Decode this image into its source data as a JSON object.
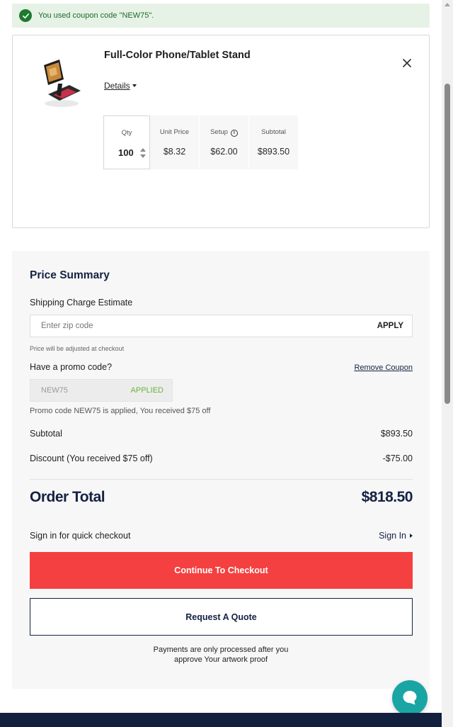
{
  "banner": {
    "message": "You used coupon code \"NEW75\"."
  },
  "cart_item": {
    "title": "Full-Color Phone/Tablet Stand",
    "details_label": "Details",
    "qty_label": "Qty",
    "qty_value": "100",
    "unit_price_label": "Unit Price",
    "unit_price_value": "$8.32",
    "setup_label": "Setup",
    "setup_value": "$62.00",
    "subtotal_label": "Subtotal",
    "subtotal_value": "$893.50"
  },
  "summary": {
    "title": "Price Summary",
    "shipping_label": "Shipping Charge Estimate",
    "zip_placeholder": "Enter zip code",
    "apply_label": "APPLY",
    "price_note": "Price will be adjusted at checkout",
    "promo_label": "Have a promo code?",
    "remove_coupon_label": "Remove Coupon",
    "promo_code": "NEW75",
    "applied_label": "APPLIED",
    "promo_note": "Promo code NEW75 is applied, You received $75 off",
    "subtotal_label": "Subtotal",
    "subtotal_value": "$893.50",
    "discount_label": "Discount (You received $75 off)",
    "discount_value": "-$75.00",
    "total_label": "Order Total",
    "total_value": "$818.50",
    "signin_prompt": "Sign in for quick checkout",
    "signin_label": "Sign In",
    "checkout_label": "Continue To Checkout",
    "quote_label": "Request A Quote",
    "payment_note_line1": "Payments are only processed after you",
    "payment_note_line2": "approve Your artwork proof"
  },
  "colors": {
    "accent_red": "#f44040",
    "navy": "#142242",
    "success_green": "#1e7a2e",
    "applied_green": "#6cb33e",
    "chat_teal": "#1aa5a5"
  }
}
